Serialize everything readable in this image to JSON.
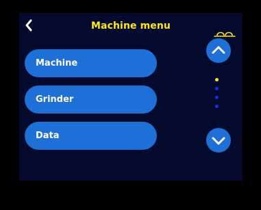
{
  "header": {
    "title": "Machine menu",
    "back_icon": "chevron-left-icon",
    "status_icon": "coffee-cups-icon"
  },
  "menu": {
    "items": [
      {
        "label": "Machine"
      },
      {
        "label": "Grinder"
      },
      {
        "label": "Data"
      }
    ]
  },
  "scroll": {
    "up_icon": "chevron-up-icon",
    "down_icon": "chevron-down-icon",
    "page_count": 4,
    "current_page": 1
  },
  "colors": {
    "background": "#000000",
    "screen": "#030a2e",
    "accent": "#ffe81a",
    "button": "#1e6fd6",
    "dot_inactive": "#1a2fe6",
    "text": "#ffffff"
  }
}
